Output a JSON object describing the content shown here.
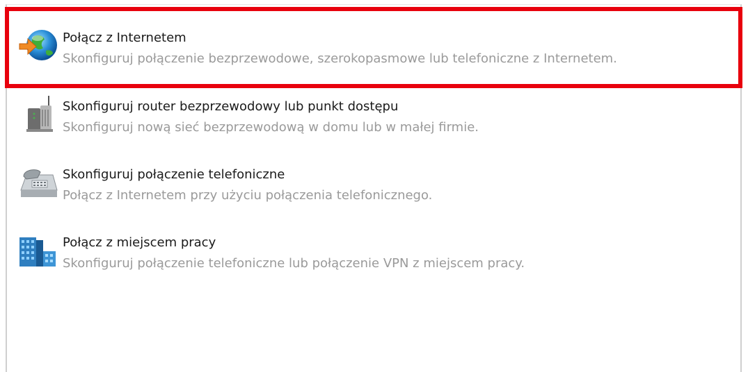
{
  "options": [
    {
      "title": "Połącz z Internetem",
      "description": "Skonfiguruj połączenie bezprzewodowe, szerokopasmowe lub telefoniczne z Internetem.",
      "icon": "globe-arrow-icon"
    },
    {
      "title": "Skonfiguruj router bezprzewodowy lub punkt dostępu",
      "description": "Skonfiguruj nową sieć bezprzewodową w domu lub w małej firmie.",
      "icon": "wireless-router-icon"
    },
    {
      "title": "Skonfiguruj połączenie telefoniczne",
      "description": "Połącz z Internetem przy użyciu połączenia telefonicznego.",
      "icon": "telephone-icon"
    },
    {
      "title": "Połącz z miejscem pracy",
      "description": "Skonfiguruj połączenie telefoniczne lub połączenie VPN z miejscem pracy.",
      "icon": "workplace-building-icon"
    }
  ],
  "highlight_color": "#e8000d"
}
